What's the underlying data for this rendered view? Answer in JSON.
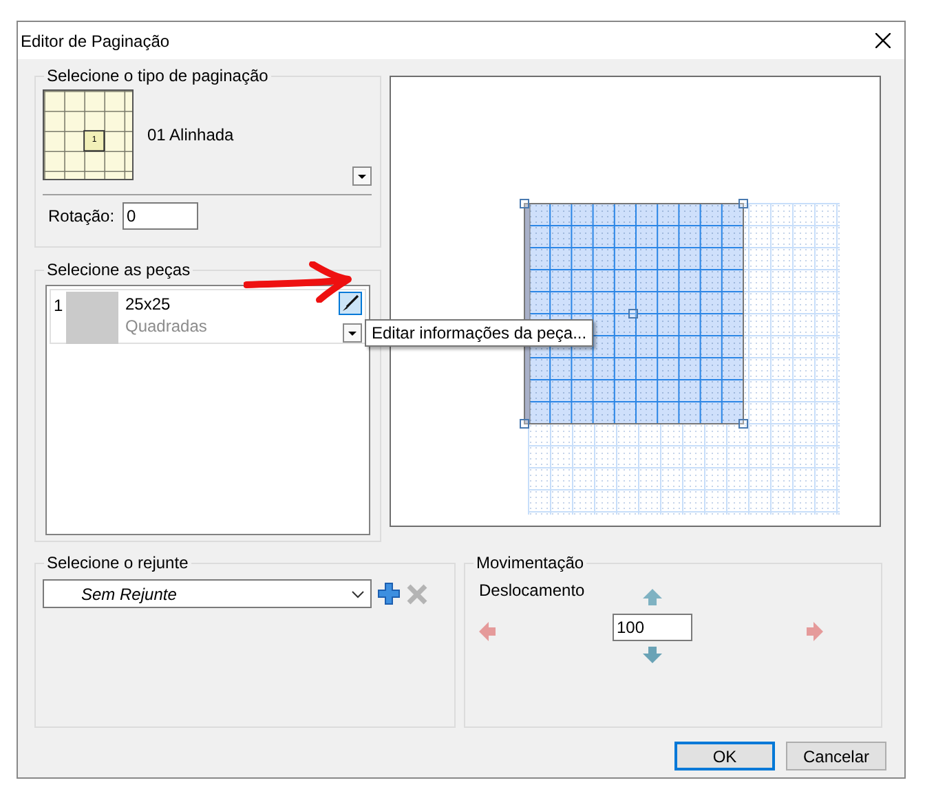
{
  "window": {
    "title": "Editor de Paginação"
  },
  "pagination_type": {
    "legend": "Selecione o tipo de paginação",
    "preview_label": "1",
    "name": "01 Alinhada",
    "rotation_label": "Rotação:",
    "rotation": "0"
  },
  "pieces": {
    "legend": "Selecione as peças",
    "items": [
      {
        "index": "1",
        "name": "25x25",
        "category": "Quadradas"
      }
    ]
  },
  "tooltip": "Editar informações da peça...",
  "grout": {
    "legend": "Selecione o rejunte",
    "value": "Sem Rejunte"
  },
  "movement": {
    "legend": "Movimentação",
    "label": "Deslocamento",
    "step": "100"
  },
  "buttons": [
    {
      "label": "OK",
      "default": true
    },
    {
      "label": "Cancelar",
      "default": false
    }
  ]
}
